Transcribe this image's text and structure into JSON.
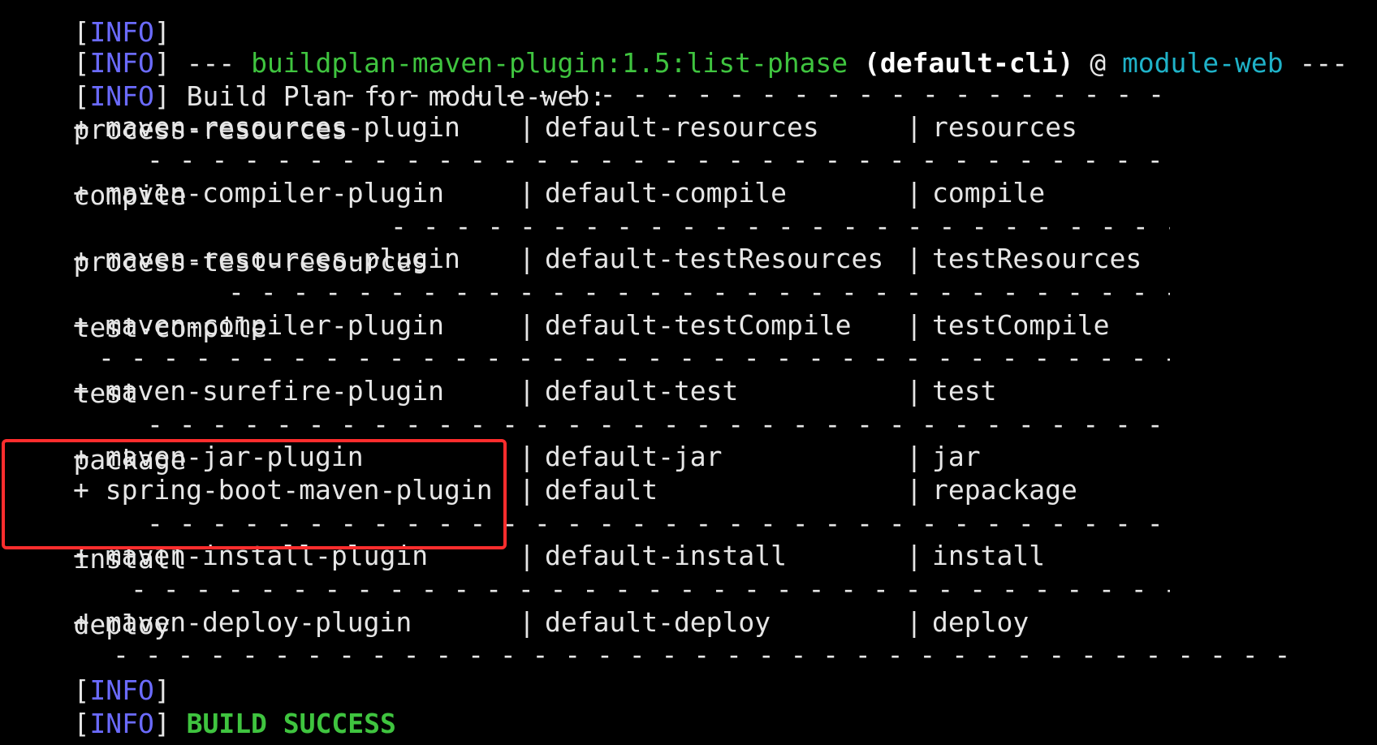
{
  "terminal": {
    "top_partial": {
      "open": "[",
      "info": "INFO",
      "close": "]"
    },
    "header_line": {
      "open": "[",
      "info": "INFO",
      "close": "]",
      "sep_open": " --- ",
      "plugin": "buildplan-maven-plugin:1.5:list-phase",
      "exec": " (default-cli) ",
      "at": "@ ",
      "module": "module-web",
      "sep_close": " ---"
    },
    "build_plan_line": {
      "open": "[",
      "info": "INFO",
      "close": "]",
      "text": " Build Plan for module-web:"
    },
    "phases": [
      {
        "name": "process-resources",
        "plugins": [
          {
            "plugin": "+ maven-resources-plugin",
            "execution": "default-resources",
            "goal": "resources"
          }
        ]
      },
      {
        "name": "compile",
        "plugins": [
          {
            "plugin": "+ maven-compiler-plugin",
            "execution": "default-compile",
            "goal": "compile"
          }
        ]
      },
      {
        "name": "process-test-resources",
        "plugins": [
          {
            "plugin": "+ maven-resources-plugin",
            "execution": "default-testResources",
            "goal": "testResources"
          }
        ]
      },
      {
        "name": "test-compile",
        "plugins": [
          {
            "plugin": "+ maven-compiler-plugin",
            "execution": "default-testCompile",
            "goal": "testCompile"
          }
        ]
      },
      {
        "name": "test",
        "plugins": [
          {
            "plugin": "+ maven-surefire-plugin",
            "execution": "default-test",
            "goal": "test"
          }
        ]
      },
      {
        "name": "package",
        "plugins": [
          {
            "plugin": "+ maven-jar-plugin",
            "execution": "default-jar",
            "goal": "jar"
          },
          {
            "plugin": "+ spring-boot-maven-plugin",
            "execution": "default",
            "goal": "repackage"
          }
        ]
      },
      {
        "name": "install",
        "plugins": [
          {
            "plugin": "+ maven-install-plugin",
            "execution": "default-install",
            "goal": "install"
          }
        ]
      },
      {
        "name": "deploy",
        "plugins": [
          {
            "plugin": "+ maven-deploy-plugin",
            "execution": "default-deploy",
            "goal": "deploy"
          }
        ]
      }
    ],
    "pipe": "|",
    "separator_line": {
      "open": "[",
      "info": "INFO",
      "close": "]"
    },
    "status_line": {
      "open": "[",
      "info": "INFO",
      "close": "]",
      "text": " BUILD SUCCESS"
    },
    "colors": {
      "background": "#000000",
      "text": "#e6e6e6",
      "info": "#6b6bff",
      "plugin_green": "#3fc43f",
      "module_cyan": "#1fb2c8",
      "highlight_red": "#ff2d2d"
    }
  }
}
